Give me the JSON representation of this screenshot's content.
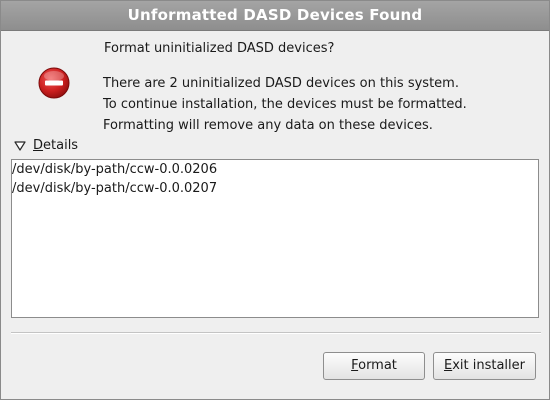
{
  "window": {
    "title": "Unformatted DASD Devices Found"
  },
  "dialog": {
    "question": "Format uninitialized DASD devices?",
    "message_lines": [
      "There are 2 uninitialized DASD devices on this system.",
      "To continue installation, the devices must be formatted.",
      "Formatting will remove any data on these devices."
    ],
    "icon": "stop-icon",
    "colors": {
      "titlebar": "#999999",
      "icon_red": "#cc1f1f",
      "background": "#efefef"
    }
  },
  "details": {
    "mnemonic": "D",
    "label_rest": "etails",
    "expanded": true,
    "items": [
      "/dev/disk/by-path/ccw-0.0.0206",
      "/dev/disk/by-path/ccw-0.0.0207"
    ]
  },
  "buttons": {
    "format": {
      "mnemonic": "F",
      "rest": "ormat"
    },
    "exit": {
      "mnemonic": "E",
      "rest": "xit installer"
    }
  }
}
